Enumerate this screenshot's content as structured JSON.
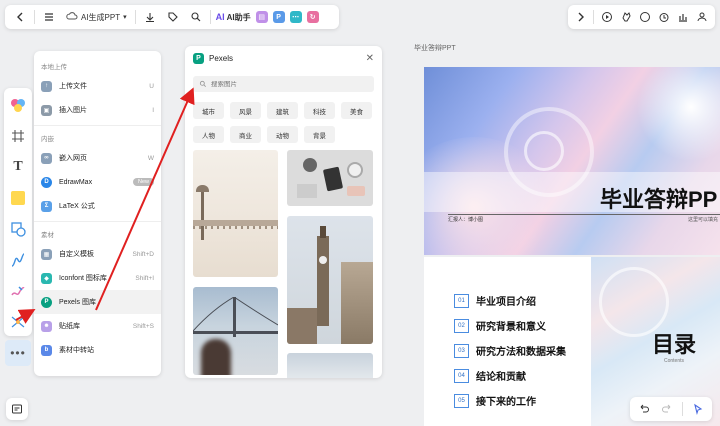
{
  "toolbar": {
    "doc_title": "AI生成PPT",
    "ai_label": "AI助手",
    "mini_icons": [
      "slides-icon",
      "p-icon",
      "mindmap-icon",
      "flow-icon"
    ]
  },
  "menu": {
    "sections": [
      {
        "title": "本地上传",
        "items": [
          {
            "label": "上传文件",
            "shortcut": "U",
            "icon": "cloud-upload-icon",
            "color": "#8aa0b8"
          },
          {
            "label": "插入图片",
            "shortcut": "I",
            "icon": "image-icon",
            "color": "#8c9aa8"
          }
        ]
      },
      {
        "title": "内嵌",
        "items": [
          {
            "label": "嵌入网页",
            "shortcut": "W",
            "icon": "link-icon",
            "color": "#8aa0b8"
          },
          {
            "label": "EdrawMax",
            "shortcut": "New",
            "icon": "edrawmax-icon",
            "color": "#2a86e8"
          },
          {
            "label": "LaTeX 公式",
            "shortcut": "",
            "icon": "latex-icon",
            "color": "#5aa0e8"
          }
        ]
      },
      {
        "title": "素材",
        "items": [
          {
            "label": "自定义模板",
            "shortcut": "Shift+D",
            "icon": "template-icon",
            "color": "#8aa0b8"
          },
          {
            "label": "Iconfont 图标库",
            "shortcut": "Shift+I",
            "icon": "iconfont-icon",
            "color": "#2ab8b0"
          },
          {
            "label": "Pexels 图库",
            "shortcut": "",
            "icon": "pexels-icon",
            "color": "#07a081"
          },
          {
            "label": "贴纸库",
            "shortcut": "Shift+S",
            "icon": "sticker-icon",
            "color": "#b8a0e8"
          },
          {
            "label": "素材中转站",
            "shortcut": "",
            "icon": "transfer-icon",
            "color": "#5a88e8"
          }
        ]
      }
    ]
  },
  "pexels": {
    "title": "Pexels",
    "search_placeholder": "搜索图片",
    "tags": [
      "城市",
      "风景",
      "建筑",
      "科技",
      "美食",
      "人物",
      "商业",
      "动物",
      "背景"
    ]
  },
  "slides": {
    "label": "毕业答辩PPT",
    "cover_title": "毕业答辩PP",
    "cover_reporter": "汇报人：博小图",
    "cover_note": "这里可以填充",
    "toc_title": "目录",
    "toc_sub": "Contents",
    "toc_items": [
      {
        "num": "01",
        "text": "毕业项目介绍"
      },
      {
        "num": "02",
        "text": "研究背景和意义"
      },
      {
        "num": "03",
        "text": "研究方法和数据采集"
      },
      {
        "num": "04",
        "text": "结论和贡献"
      },
      {
        "num": "05",
        "text": "接下来的工作"
      }
    ]
  },
  "colors": {
    "accent": "#2e6fc4",
    "pexels": "#07a081",
    "arrow": "#e02020"
  }
}
